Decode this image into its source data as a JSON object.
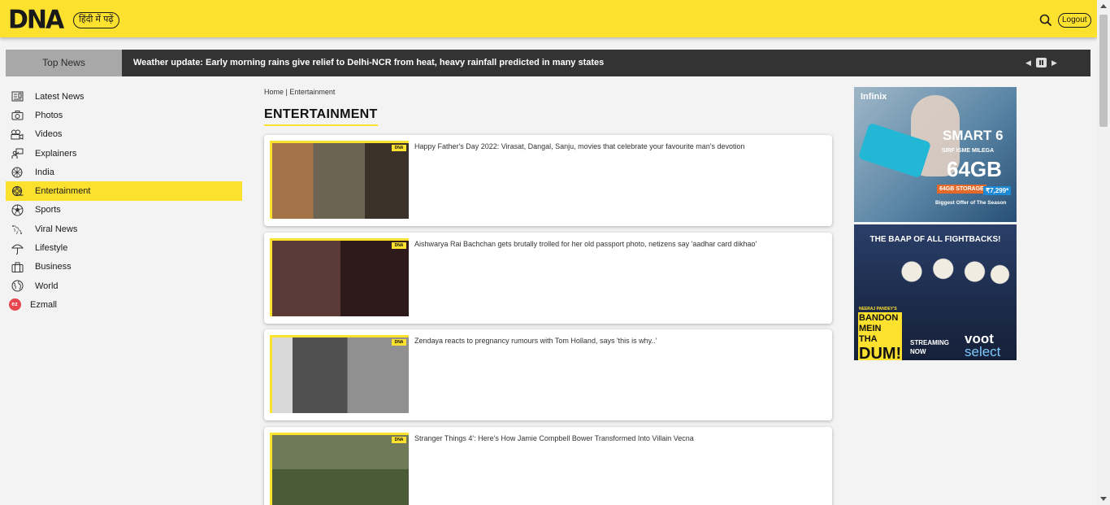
{
  "header": {
    "logo": "DNA",
    "lang_button": "हिंदी में पढ़ें",
    "logout_label": "Logout"
  },
  "ticker": {
    "tab_label": "Top News",
    "headline": "Weather update: Early morning rains give relief to Delhi-NCR from heat, heavy rainfall predicted in many states"
  },
  "sidebar": {
    "items": [
      {
        "label": "Latest News",
        "icon": "newspaper-icon"
      },
      {
        "label": "Photos",
        "icon": "camera-icon"
      },
      {
        "label": "Videos",
        "icon": "video-camera-icon"
      },
      {
        "label": "Explainers",
        "icon": "presenter-icon"
      },
      {
        "label": "India",
        "icon": "ashoka-chakra-icon"
      },
      {
        "label": "Entertainment",
        "icon": "film-reel-icon",
        "active": true
      },
      {
        "label": "Sports",
        "icon": "football-icon"
      },
      {
        "label": "Viral News",
        "icon": "viral-icon"
      },
      {
        "label": "Lifestyle",
        "icon": "umbrella-icon"
      },
      {
        "label": "Business",
        "icon": "briefcase-icon"
      },
      {
        "label": "World",
        "icon": "globe-icon"
      },
      {
        "label": "Ezmall",
        "icon": "ezmall-logo-icon",
        "badge": "ez"
      }
    ]
  },
  "main": {
    "breadcrumb": "Home | Entertainment",
    "section_title": "ENTERTAINMENT",
    "thumb_tag": "DNA",
    "articles": [
      {
        "title": "Happy Father's Day 2022: Virasat, Dangal, Sanju, movies that celebrate your favourite man's devotion"
      },
      {
        "title": "Aishwarya Rai Bachchan gets brutally trolled for her old passport photo, netizens say 'aadhar card dikhao'"
      },
      {
        "title": "Zendaya reacts to pregnancy rumours with Tom Holland, says 'this is why..'"
      },
      {
        "title": "Stranger Things 4': Here's How Jamie Compbell Bower Transformed Into Villain Vecna"
      }
    ]
  },
  "ads": {
    "ad1": {
      "brand": "Infinix",
      "model": "SMART 6",
      "sub": "SIRF ISME MILEGA",
      "storage": "64GB",
      "offer_box": "64GB STORAGE",
      "price": "₹7,299*",
      "offer": "Biggest Offer of The Season"
    },
    "ad2": {
      "headline": "THE BAAP OF ALL FIGHTBACKS!",
      "small": "NEERAJ PANDEY'S",
      "title_line1": "BANDON",
      "title_line2": "MEIN THA",
      "title_line3": "DUM!",
      "stream_line1": "STREAMING",
      "stream_line2": "NOW",
      "brand_line1": "voot",
      "brand_line2": "select"
    }
  },
  "colors": {
    "brand_yellow": "#fde12f",
    "ticker_bg": "#333333",
    "page_bg": "#f3f3f3"
  }
}
